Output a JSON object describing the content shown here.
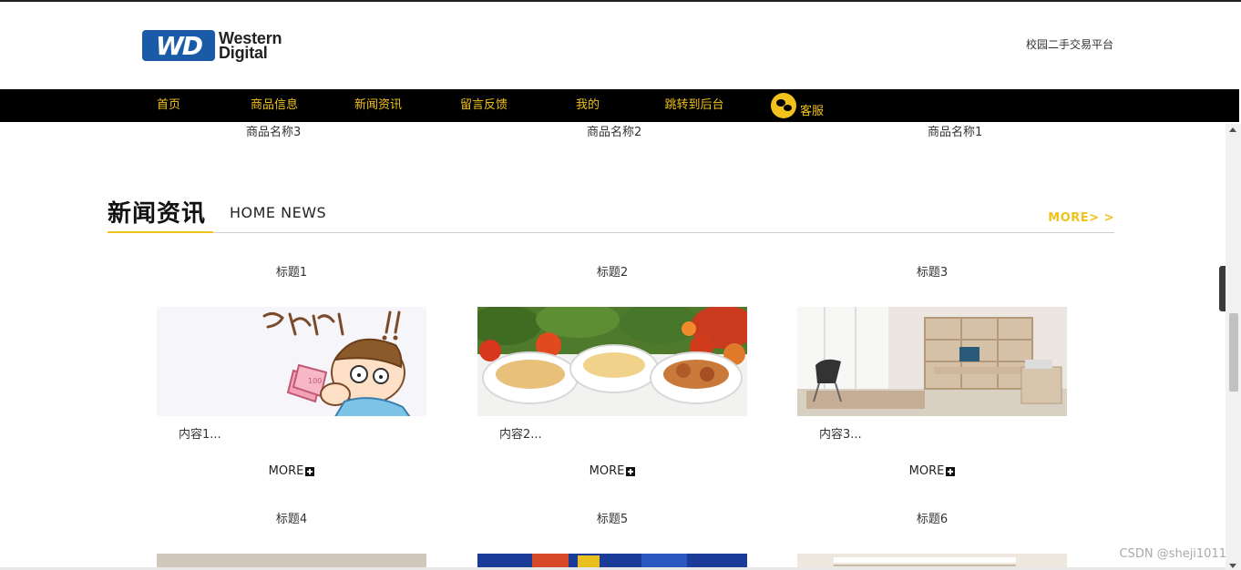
{
  "header": {
    "logo_mark": "WD",
    "logo_line1": "Western",
    "logo_line2": "Digital",
    "site_name": "校园二手交易平台"
  },
  "nav": {
    "items": [
      {
        "label": "首页"
      },
      {
        "label": "商品信息"
      },
      {
        "label": "新闻资讯"
      },
      {
        "label": "留言反馈"
      },
      {
        "label": "我的"
      },
      {
        "label": "跳转到后台"
      }
    ],
    "service_label": "客服"
  },
  "products": [
    {
      "name": "商品名称3"
    },
    {
      "name": "商品名称2"
    },
    {
      "name": "商品名称1"
    }
  ],
  "news_section": {
    "title": "新闻资讯",
    "subtitle": "HOME NEWS",
    "more": "MORE> >"
  },
  "news": [
    {
      "title": "标题1",
      "content": "内容1...",
      "more": "MORE",
      "image": "cartoon"
    },
    {
      "title": "标题2",
      "content": "内容2...",
      "more": "MORE",
      "image": "food"
    },
    {
      "title": "标题3",
      "content": "内容3...",
      "more": "MORE",
      "image": "furniture"
    },
    {
      "title": "标题4"
    },
    {
      "title": "标题5"
    },
    {
      "title": "标题6"
    }
  ],
  "watermark": "CSDN @sheji1011",
  "colors": {
    "accent": "#f1c21b",
    "nav_bg": "#000000",
    "logo_blue": "#1a5aa6"
  }
}
